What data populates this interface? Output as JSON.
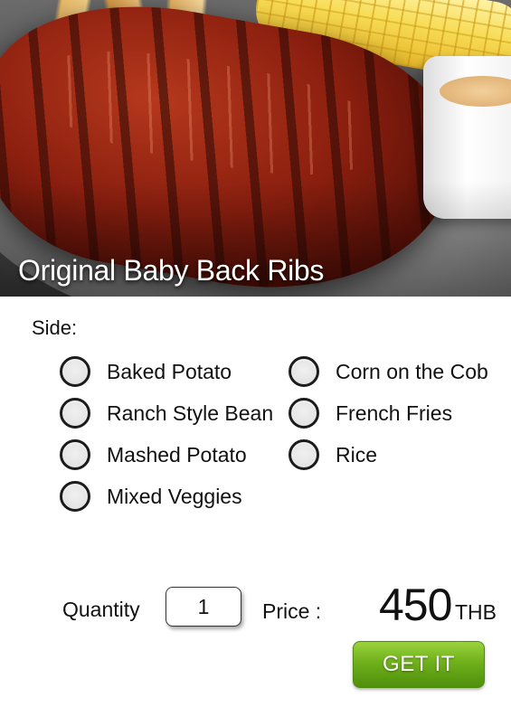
{
  "product": {
    "title": "Original Baby Back Ribs"
  },
  "side": {
    "label": "Side:",
    "options": [
      {
        "label": "Baked Potato",
        "selected": false
      },
      {
        "label": "Corn on the Cob",
        "selected": false
      },
      {
        "label": "Ranch Style Bean",
        "selected": false
      },
      {
        "label": "French Fries",
        "selected": false
      },
      {
        "label": "Mashed Potato",
        "selected": false
      },
      {
        "label": "Rice",
        "selected": false
      },
      {
        "label": "Mixed Veggies",
        "selected": false
      }
    ]
  },
  "order": {
    "quantity_label": "Quantity",
    "quantity_value": "1",
    "price_label": "Price :",
    "price_value": "450",
    "currency": "THB",
    "button_label": "GET IT"
  },
  "colors": {
    "button": "#6fb01b",
    "radio_border": "#1c1c1c"
  }
}
